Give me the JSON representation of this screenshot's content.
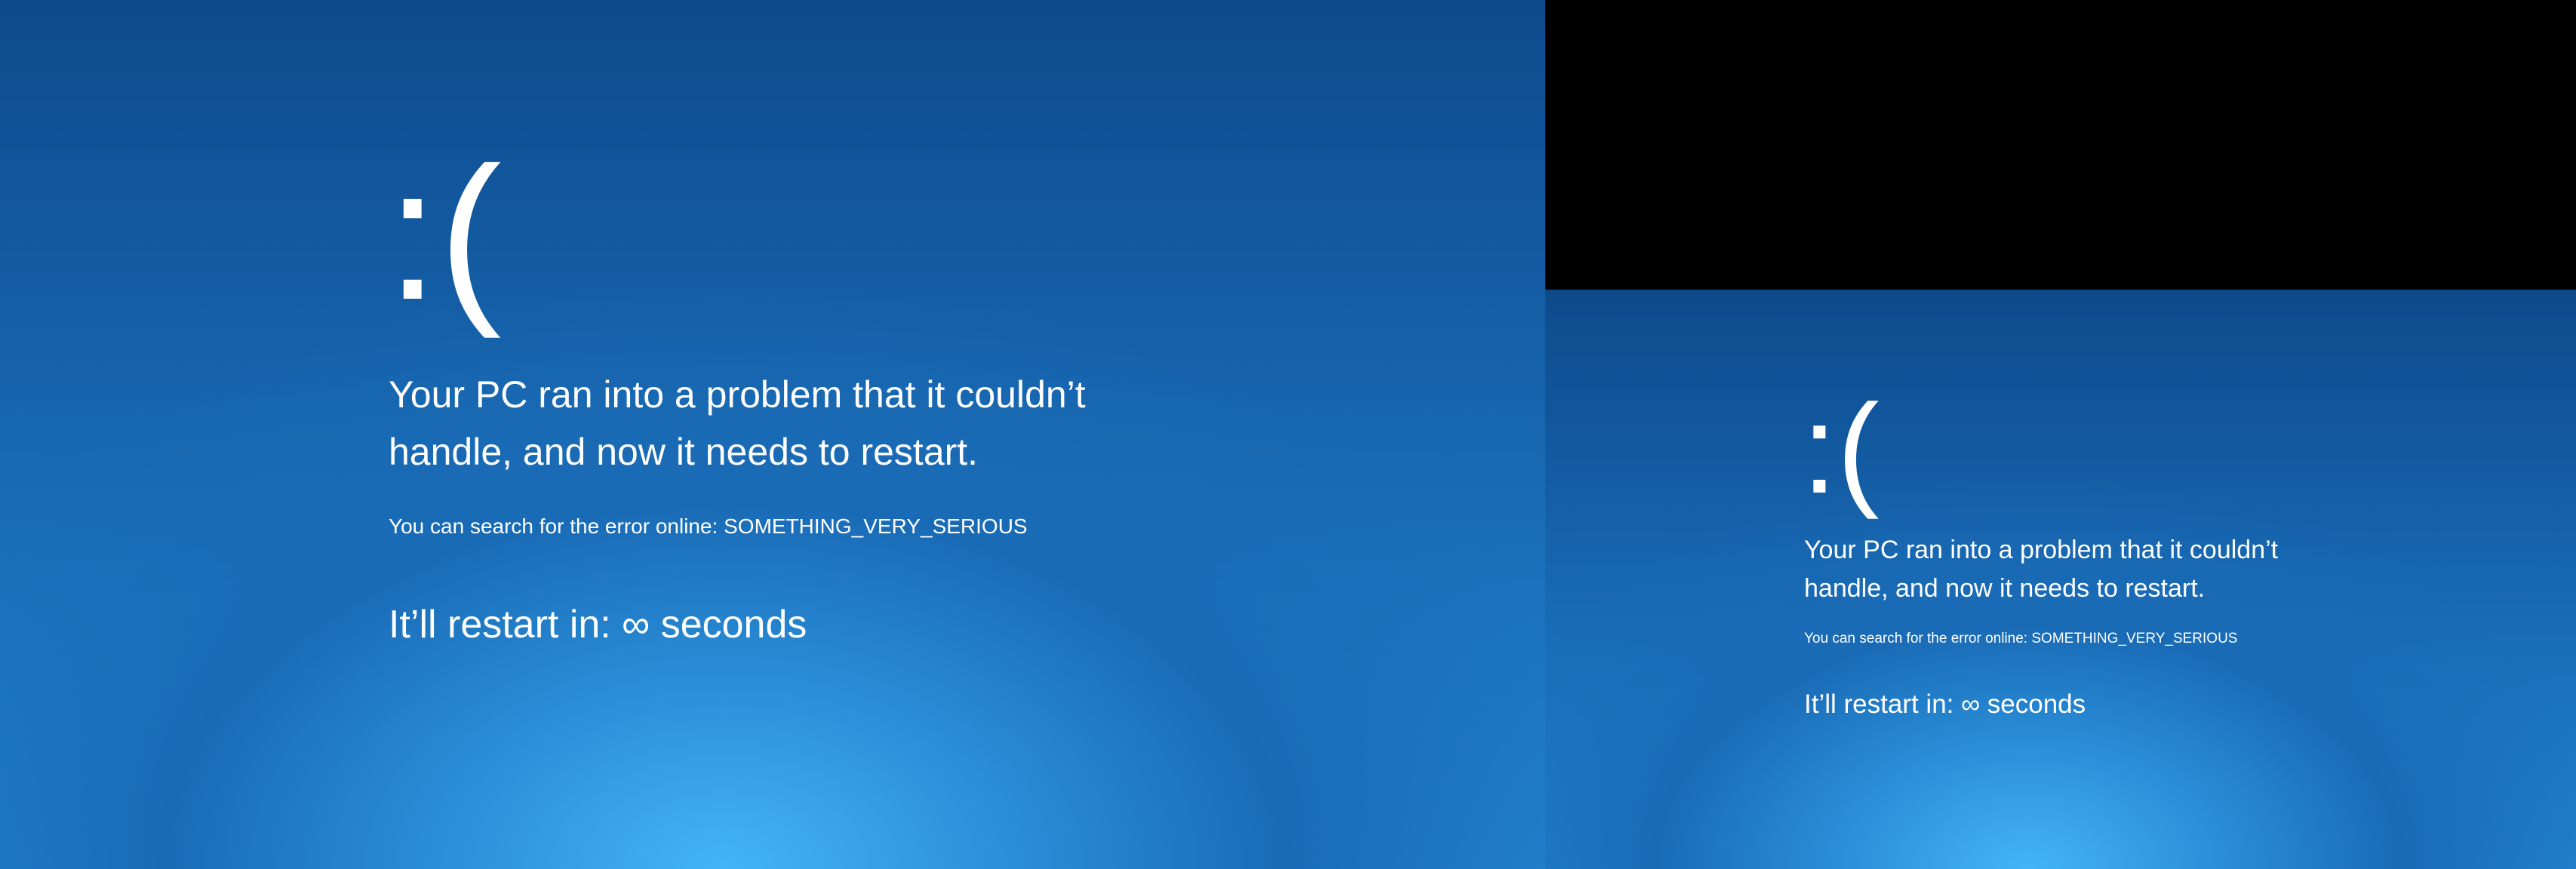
{
  "screens": [
    {
      "id": "primary-display",
      "frown": ":(",
      "headline_line1": "Your PC ran into a problem that it couldn’t",
      "headline_line2": "handle, and now it needs to restart.",
      "search_text": "You can search for the error online: SOMETHING_VERY_SERIOUS",
      "restart_text": "It’ll restart in: ∞ seconds"
    },
    {
      "id": "secondary-display",
      "frown": ":(",
      "headline_line1": "Your PC ran into a problem that it couldn’t",
      "headline_line2": "handle, and now it needs to restart.",
      "search_text": "You can search for the error online: SOMETHING_VERY_SERIOUS",
      "restart_text": "It’ll restart in: ∞ seconds"
    }
  ],
  "colors": {
    "background_top": "#0d4a8c",
    "background_glow": "#44b4f6",
    "text": "#ffffff",
    "unused_area": "#000000"
  }
}
